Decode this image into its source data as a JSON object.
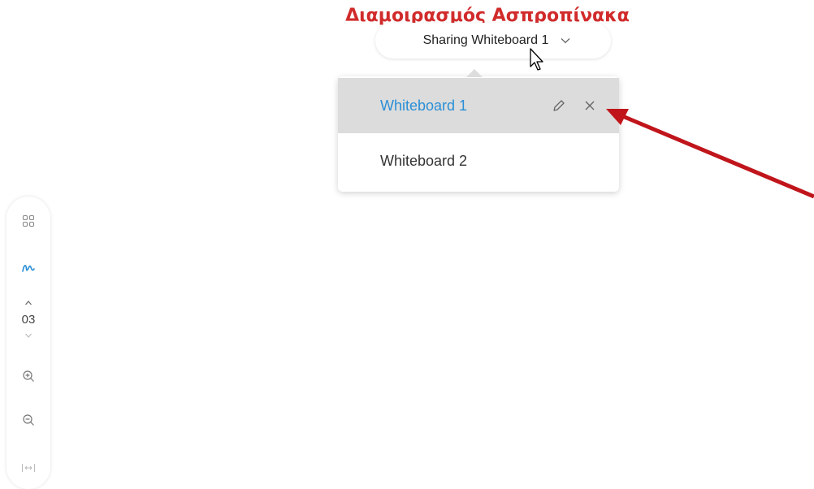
{
  "annotation": {
    "title": "Διαμοιρασμός Ασπροπίνακα"
  },
  "share": {
    "label": "Sharing Whiteboard 1"
  },
  "dropdown": {
    "items": [
      {
        "label": "Whiteboard 1",
        "active": true
      },
      {
        "label": "Whiteboard 2",
        "active": false
      }
    ]
  },
  "toolbar": {
    "page_number": "03",
    "tools": [
      "grid-icon",
      "pen-icon",
      "chevron-up-icon",
      "chevron-down-icon",
      "zoom-in-icon",
      "zoom-out-icon",
      "fit-width-icon"
    ]
  },
  "colors": {
    "annotation": "#d12b2b",
    "active_item_text": "#2b8fd6",
    "active_item_bg": "#dcdcdc",
    "arrow": "#c0151b"
  }
}
